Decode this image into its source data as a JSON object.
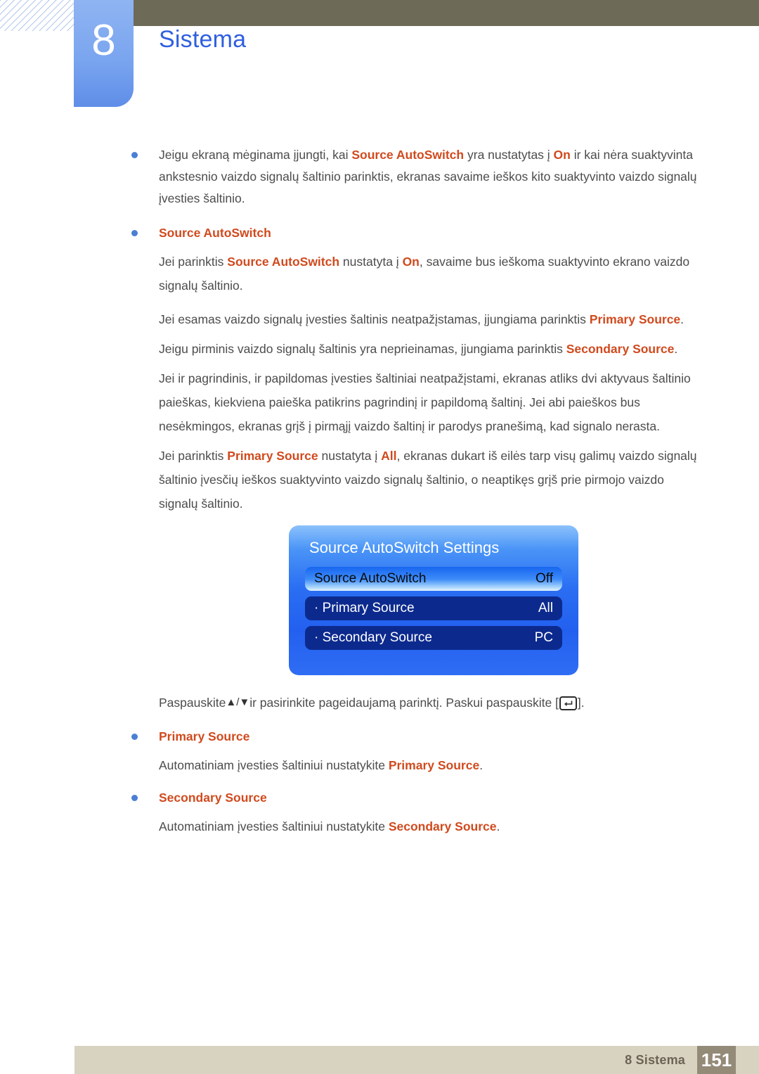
{
  "header": {
    "chapter_number": "8",
    "chapter_title": "Sistema"
  },
  "content": {
    "intro_bullet": {
      "pre": "Jeigu ekraną mėginama įjungti, kai ",
      "hl1": "Source AutoSwitch",
      "mid": " yra nustatytas į ",
      "hl2": "On",
      "post": " ir kai nėra suaktyvinta ankstesnio vaizdo signalų šaltinio parinktis, ekranas savaime ieškos kito suaktyvinto vaizdo signalų įvesties šaltinio."
    },
    "section1_heading": "Source AutoSwitch",
    "p1": {
      "pre": "Jei parinktis ",
      "hl1": "Source AutoSwitch",
      "mid": " nustatyta į ",
      "hl2": "On",
      "post": ", savaime bus ieškoma suaktyvinto ekrano vaizdo signalų šaltinio."
    },
    "p2": {
      "pre": "Jei esamas vaizdo signalų įvesties šaltinis neatpažįstamas, įjungiama parinktis ",
      "hl1": "Primary Source",
      "post": "."
    },
    "p3": {
      "pre": "Jeigu pirminis vaizdo signalų šaltinis yra neprieinamas, įjungiama parinktis ",
      "hl1": "Secondary Source",
      "post": "."
    },
    "p4": "Jei ir pagrindinis, ir papildomas įvesties šaltiniai neatpažįstami, ekranas atliks dvi aktyvaus šaltinio paieškas, kiekviena paieška patikrins pagrindinį ir papildomą šaltinį. Jei abi paieškos bus nesėkmingos, ekranas grįš į pirmąjį vaizdo šaltinį ir parodys pranešimą, kad signalo nerasta.",
    "p5": {
      "pre": "Jei parinktis ",
      "hl1": "Primary Source",
      "mid": " nustatyta į ",
      "hl2": "All",
      "post": ", ekranas dukart iš eilės tarp visų galimų vaizdo signalų šaltinio įvesčių ieškos suaktyvinto vaizdo signalų šaltinio, o neaptikęs grįš prie pirmojo vaizdo signalų šaltinio."
    },
    "press_line": {
      "pre": "Paspauskite ",
      "arrow_up": "▲",
      "slash": "/",
      "arrow_down": "▼",
      "mid": " ir pasirinkite pageidaujamą parinktį. Paskui paspauskite [",
      "enter_icon": "enter-key-icon",
      "post": "]."
    },
    "section2_heading": "Primary Source",
    "p6": {
      "pre": "Automatiniam įvesties šaltiniui nustatykite ",
      "hl1": "Primary Source",
      "post": "."
    },
    "section3_heading": "Secondary Source",
    "p7": {
      "pre": "Automatiniam įvesties šaltiniui nustatykite ",
      "hl1": "Secondary Source",
      "post": "."
    }
  },
  "osd": {
    "title": "Source AutoSwitch Settings",
    "rows": [
      {
        "label": "Source AutoSwitch",
        "value": "Off",
        "selected": true
      },
      {
        "label": "· Primary Source",
        "value": "All",
        "selected": false
      },
      {
        "label": "· Secondary Source",
        "value": "PC",
        "selected": false
      }
    ]
  },
  "footer": {
    "label": "8 Sistema",
    "page": "151"
  },
  "colors": {
    "accent_orange": "#d04a1e",
    "chapter_blue": "#2f5fe0",
    "header_olive": "#6d6a57",
    "footer_beige": "#d8d3c0",
    "footer_page_box": "#948a78",
    "osd_blue": "#2a6ef3",
    "osd_row_navy": "#0c2a8e"
  }
}
